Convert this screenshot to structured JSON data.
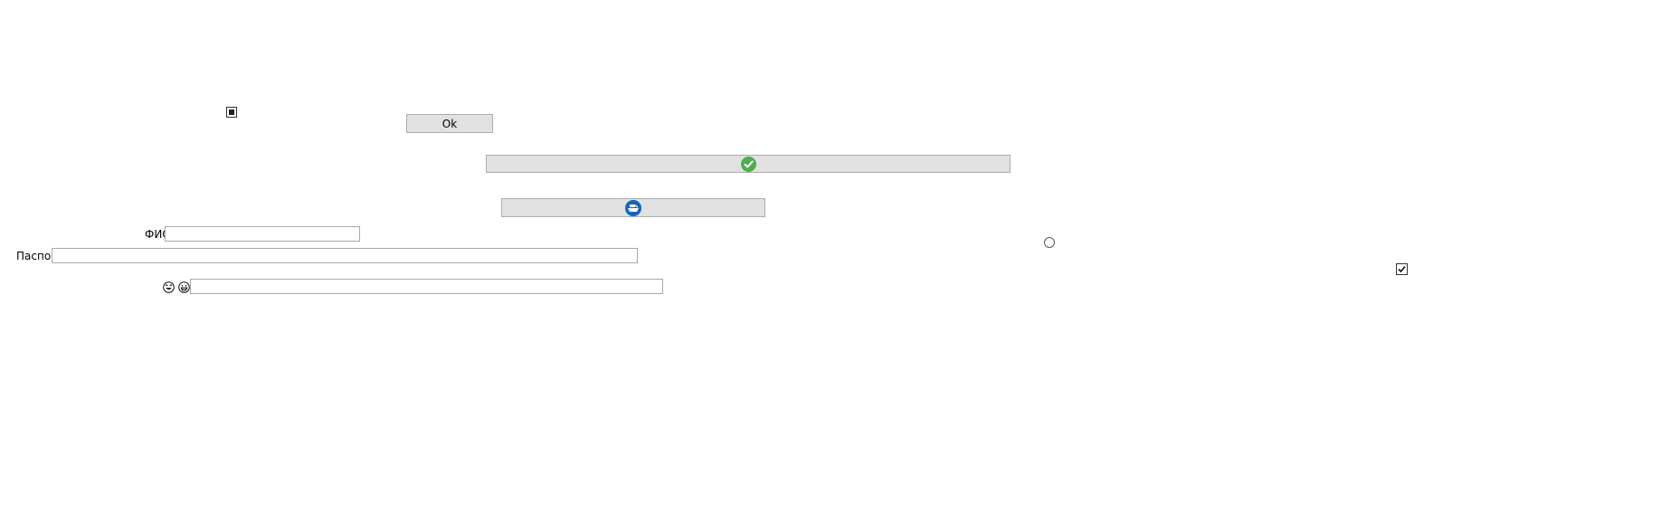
{
  "buttons": {
    "ok_label": "Ok"
  },
  "form": {
    "fio_label": "ФИО",
    "fio_value": "",
    "passport_label": "Паспорт",
    "passport_value": "",
    "text_field_value": ""
  },
  "icons": {
    "check_circle": "check-circle-icon",
    "ship": "ship-icon",
    "laughing_face": "laughing-face-icon",
    "grinning_face": "grinning-face-icon"
  },
  "colors": {
    "button_bg": "#e1e1e1",
    "success_green": "#4cae4c",
    "ship_blue": "#1565c0"
  },
  "controls": {
    "checkbox_top_checked": true,
    "checkbox_right_checked": true,
    "radio_checked": false
  }
}
